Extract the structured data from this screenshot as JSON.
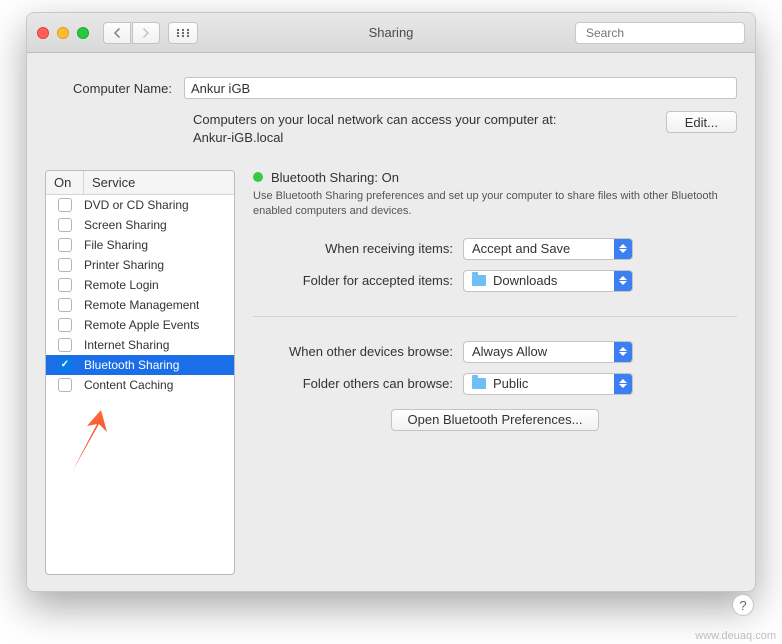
{
  "window": {
    "title": "Sharing"
  },
  "search": {
    "placeholder": "Search"
  },
  "computerName": {
    "label": "Computer Name:",
    "value": "Ankur iGB",
    "sub1": "Computers on your local network can access your computer at:",
    "sub2": "Ankur-iGB.local",
    "edit": "Edit..."
  },
  "columns": {
    "on": "On",
    "service": "Service"
  },
  "services": [
    {
      "label": "DVD or CD Sharing",
      "checked": false,
      "selected": false
    },
    {
      "label": "Screen Sharing",
      "checked": false,
      "selected": false
    },
    {
      "label": "File Sharing",
      "checked": false,
      "selected": false
    },
    {
      "label": "Printer Sharing",
      "checked": false,
      "selected": false
    },
    {
      "label": "Remote Login",
      "checked": false,
      "selected": false
    },
    {
      "label": "Remote Management",
      "checked": false,
      "selected": false
    },
    {
      "label": "Remote Apple Events",
      "checked": false,
      "selected": false
    },
    {
      "label": "Internet Sharing",
      "checked": false,
      "selected": false
    },
    {
      "label": "Bluetooth Sharing",
      "checked": true,
      "selected": true
    },
    {
      "label": "Content Caching",
      "checked": false,
      "selected": false
    }
  ],
  "detail": {
    "status": "Bluetooth Sharing: On",
    "desc": "Use Bluetooth Sharing preferences and set up your computer to share files with other Bluetooth enabled computers and devices.",
    "labels": {
      "recv": "When receiving items:",
      "folderAccepted": "Folder for accepted items:",
      "browse": "When other devices browse:",
      "folderBrowse": "Folder others can browse:"
    },
    "values": {
      "recv": "Accept and Save",
      "folderAccepted": "Downloads",
      "browse": "Always Allow",
      "folderBrowse": "Public"
    },
    "openPrefs": "Open Bluetooth Preferences..."
  },
  "watermark": "www.deuaq.com"
}
